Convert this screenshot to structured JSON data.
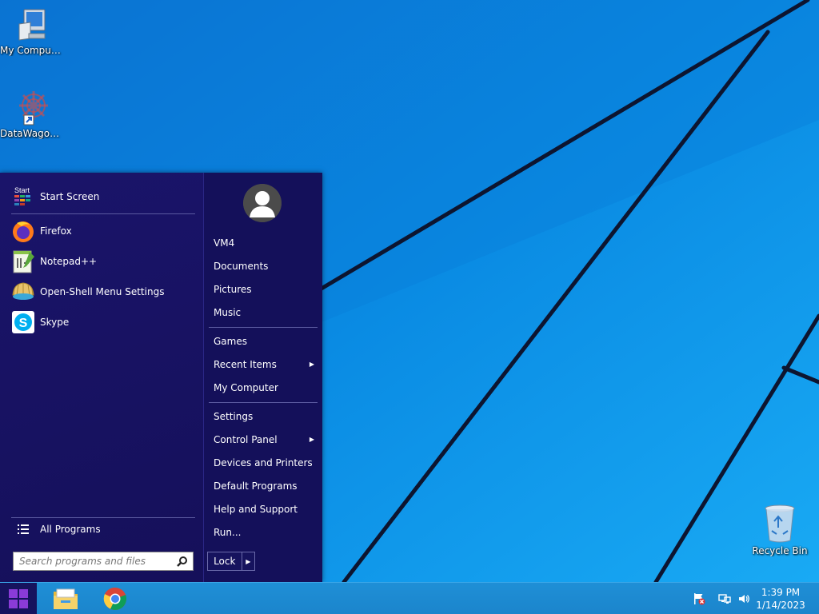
{
  "desktop": {
    "icons": [
      {
        "label": "My Computer",
        "icon": "computer-icon"
      },
      {
        "label": "DataWagon...",
        "icon": "datawagon-shortcut-icon"
      },
      {
        "label": "Recycle Bin",
        "icon": "recycle-bin-icon"
      }
    ]
  },
  "start_menu": {
    "programs": [
      {
        "label": "Start Screen",
        "icon": "start-screen-icon"
      },
      {
        "label": "Firefox",
        "icon": "firefox-icon"
      },
      {
        "label": "Notepad++",
        "icon": "notepadpp-icon"
      },
      {
        "label": "Open-Shell Menu Settings",
        "icon": "open-shell-icon"
      },
      {
        "label": "Skype",
        "icon": "skype-icon"
      }
    ],
    "start_screen_badge": "Start",
    "all_programs": "All Programs",
    "search_placeholder": "Search programs and files",
    "user": {
      "name": "VM4"
    },
    "right_items": [
      {
        "label": "VM4"
      },
      {
        "label": "Documents"
      },
      {
        "label": "Pictures"
      },
      {
        "label": "Music"
      },
      {
        "label": "Games"
      },
      {
        "label": "Recent Items",
        "submenu": true
      },
      {
        "label": "My Computer"
      },
      {
        "label": "Settings"
      },
      {
        "label": "Control Panel",
        "submenu": true
      },
      {
        "label": "Devices and Printers"
      },
      {
        "label": "Default Programs"
      },
      {
        "label": "Help and Support"
      },
      {
        "label": "Run..."
      }
    ],
    "lock_label": "Lock",
    "arrow_glyph": "▶"
  },
  "taskbar": {
    "pinned": [
      {
        "name": "File Explorer",
        "icon": "file-explorer-icon"
      },
      {
        "name": "Google Chrome",
        "icon": "chrome-icon"
      }
    ],
    "tray_icons": [
      "action-center-flag-icon",
      "network-icon",
      "volume-icon"
    ],
    "clock": {
      "time": "1:39 PM",
      "date": "1/14/2023"
    }
  },
  "colors": {
    "menu_bg": "#16135e",
    "desktop_blue": "#0a8ee4",
    "taskbar": "#1b85cc"
  }
}
